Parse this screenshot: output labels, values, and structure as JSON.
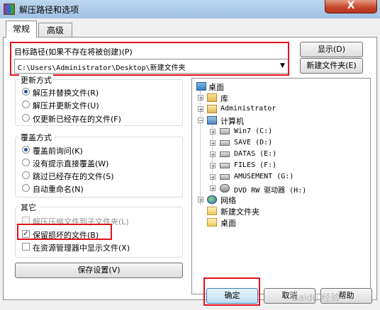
{
  "window": {
    "title": "解压路径和选项",
    "close_glyph": "X"
  },
  "tabs": [
    {
      "label": "常规",
      "active": true
    },
    {
      "label": "高级",
      "active": false
    }
  ],
  "target_path": {
    "label": "目标路径(如果不存在将被创建)(P)",
    "value": "C:\\Users\\Administrator\\Desktop\\新建文件夹",
    "dropdown_glyph": "▼"
  },
  "buttons": {
    "show": "显示(D)",
    "new_folder": "新建文件夹(E)",
    "save_settings": "保存设置(V)",
    "ok": "确定",
    "cancel": "取消",
    "help": "帮助"
  },
  "update_mode": {
    "title": "更新方式",
    "options": [
      {
        "label": "解压并替换文件(R)",
        "selected": true
      },
      {
        "label": "解压并更新文件(U)",
        "selected": false
      },
      {
        "label": "仅更新已经存在的文件(F)",
        "selected": false
      }
    ]
  },
  "overwrite_mode": {
    "title": "覆盖方式",
    "options": [
      {
        "label": "覆盖前询问(K)",
        "selected": true
      },
      {
        "label": "没有提示直接覆盖(W)",
        "selected": false
      },
      {
        "label": "跳过已经存在的文件(S)",
        "selected": false
      },
      {
        "label": "自动重命名(N)",
        "selected": false
      }
    ]
  },
  "misc": {
    "title": "其它",
    "options": [
      {
        "label": "解压压缩文件到子文件夹(L)",
        "checked": false,
        "enabled": false
      },
      {
        "label": "保留损坏的文件(B)",
        "checked": true,
        "enabled": true
      },
      {
        "label": "在资源管理器中显示文件(X)",
        "checked": false,
        "enabled": true
      }
    ]
  },
  "tree": {
    "items": [
      {
        "label": "桌面",
        "icon": "desktop-icon",
        "toggle": ""
      },
      {
        "label": "库",
        "icon": "library-icon",
        "toggle": "+"
      },
      {
        "label": "Administrator",
        "icon": "user-folder-icon",
        "toggle": "+"
      },
      {
        "label": "计算机",
        "icon": "computer-icon",
        "toggle": "−"
      },
      {
        "label": "Win7 (C:)",
        "icon": "system-drive-icon",
        "toggle": "+"
      },
      {
        "label": "SAVE (D:)",
        "icon": "drive-icon",
        "toggle": "+"
      },
      {
        "label": "DATAS (E:)",
        "icon": "drive-icon",
        "toggle": "+"
      },
      {
        "label": "FILES (F:)",
        "icon": "drive-icon",
        "toggle": "+"
      },
      {
        "label": "AMUSEMENT (G:)",
        "icon": "drive-icon",
        "toggle": "+"
      },
      {
        "label": "DVD RW 驱动器 (H:)",
        "icon": "dvd-drive-icon",
        "toggle": "+"
      },
      {
        "label": "网络",
        "icon": "network-icon",
        "toggle": "+"
      },
      {
        "label": "新建文件夹",
        "icon": "folder-icon",
        "toggle": ""
      },
      {
        "label": "桌面",
        "icon": "folder-icon",
        "toggle": ""
      }
    ]
  },
  "watermark": "Baidu 经验",
  "colors": {
    "highlight_box": "#e0101b",
    "title_bar": "#9fc2e4",
    "close_button": "#c44a2c"
  }
}
